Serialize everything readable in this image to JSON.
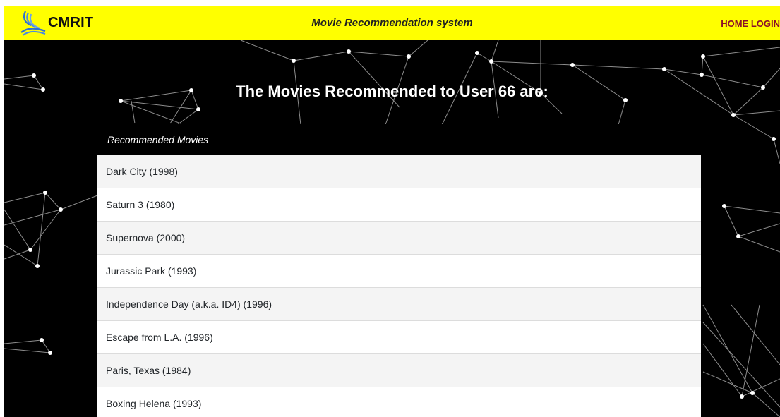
{
  "navbar": {
    "brand": "CMRIT",
    "title": "Movie Recommendation system",
    "links": [
      "HOME",
      "LOGIN"
    ],
    "logo_icon": "cmrit-logo-icon",
    "bg_color": "#ffff00",
    "link_color": "#8a0f2a"
  },
  "main": {
    "heading": "The Movies Recommended to User 66 are:",
    "table_header": "Recommended Movies",
    "movies": [
      "Dark City (1998)",
      "Saturn 3 (1980)",
      "Supernova (2000)",
      "Jurassic Park (1993)",
      "Independence Day (a.k.a. ID4) (1996)",
      "Escape from L.A. (1996)",
      "Paris, Texas (1984)",
      "Boxing Helena (1993)"
    ]
  }
}
